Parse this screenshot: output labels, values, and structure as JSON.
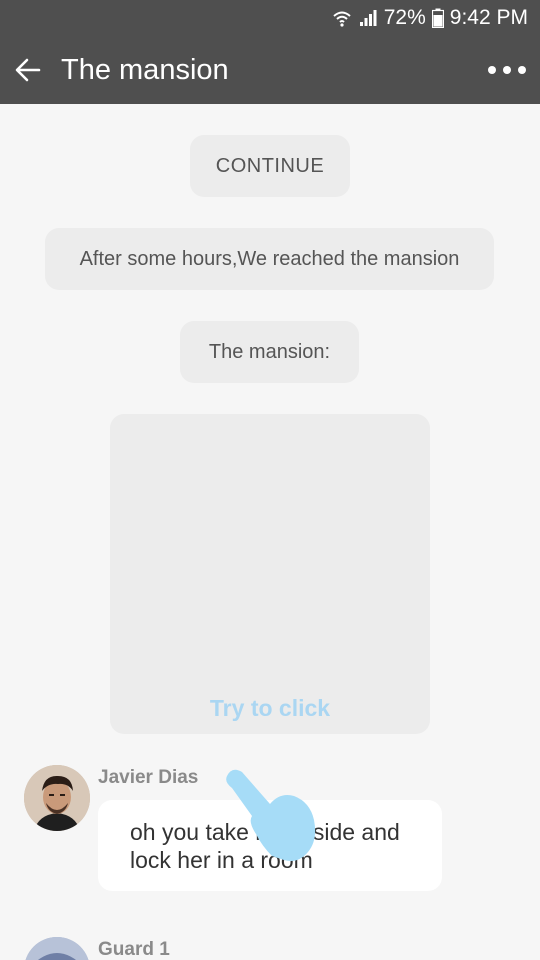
{
  "status_bar": {
    "battery": "72%",
    "time": "9:42 PM",
    "icons": [
      "wifi-icon",
      "signal-icon",
      "battery-icon"
    ]
  },
  "app_bar": {
    "title": "The mansion",
    "back_icon": "back-arrow-icon",
    "menu_icon": "more-dots-icon"
  },
  "messages": {
    "continue_label": "CONTINUE",
    "narration": "After some hours,We reached the mansion",
    "image_label": "The mansion:",
    "image_hint": "Try to click"
  },
  "chat": [
    {
      "sender": "Javier Dias",
      "text": "oh you take her inside and lock her in a room"
    },
    {
      "sender": "Guard 1",
      "text": ""
    }
  ],
  "colors": {
    "app_bar": "#4f4f4f",
    "background": "#f6f6f6",
    "pill": "#ececec",
    "hint": "#aad6f2",
    "hand": "#a6dcf7"
  }
}
